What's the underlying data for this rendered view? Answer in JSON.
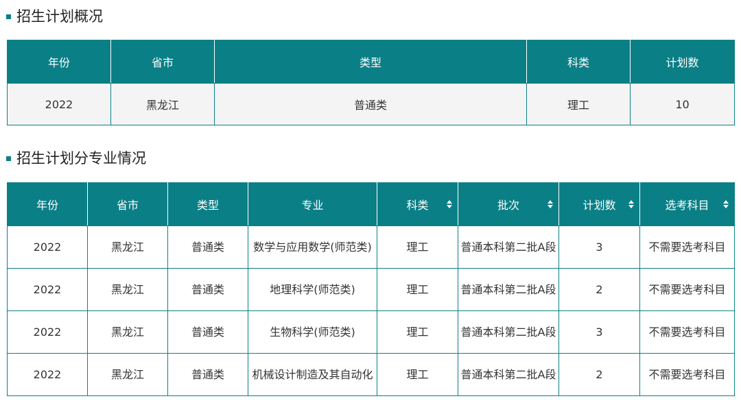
{
  "colors": {
    "accent": "#0b7f86",
    "row_bg": "#f4f4f4"
  },
  "overview": {
    "title": "招生计划概况",
    "headers": [
      "年份",
      "省市",
      "类型",
      "科类",
      "计划数"
    ],
    "row": [
      "2022",
      "黑龙江",
      "普通类",
      "理工",
      "10"
    ]
  },
  "detail": {
    "title": "招生计划分专业情况",
    "headers": [
      "年份",
      "省市",
      "类型",
      "专业",
      "科类",
      "批次",
      "计划数",
      "选考科目"
    ],
    "sortable_columns": [
      "科类",
      "批次",
      "计划数",
      "选考科目"
    ],
    "sort_icon": "sort-updown-icon",
    "rows": [
      [
        "2022",
        "黑龙江",
        "普通类",
        "数学与应用数学(师范类)",
        "理工",
        "普通本科第二批A段",
        "3",
        "不需要选考科目"
      ],
      [
        "2022",
        "黑龙江",
        "普通类",
        "地理科学(师范类)",
        "理工",
        "普通本科第二批A段",
        "2",
        "不需要选考科目"
      ],
      [
        "2022",
        "黑龙江",
        "普通类",
        "生物科学(师范类)",
        "理工",
        "普通本科第二批A段",
        "3",
        "不需要选考科目"
      ],
      [
        "2022",
        "黑龙江",
        "普通类",
        "机械设计制造及其自动化",
        "理工",
        "普通本科第二批A段",
        "2",
        "不需要选考科目"
      ]
    ]
  }
}
